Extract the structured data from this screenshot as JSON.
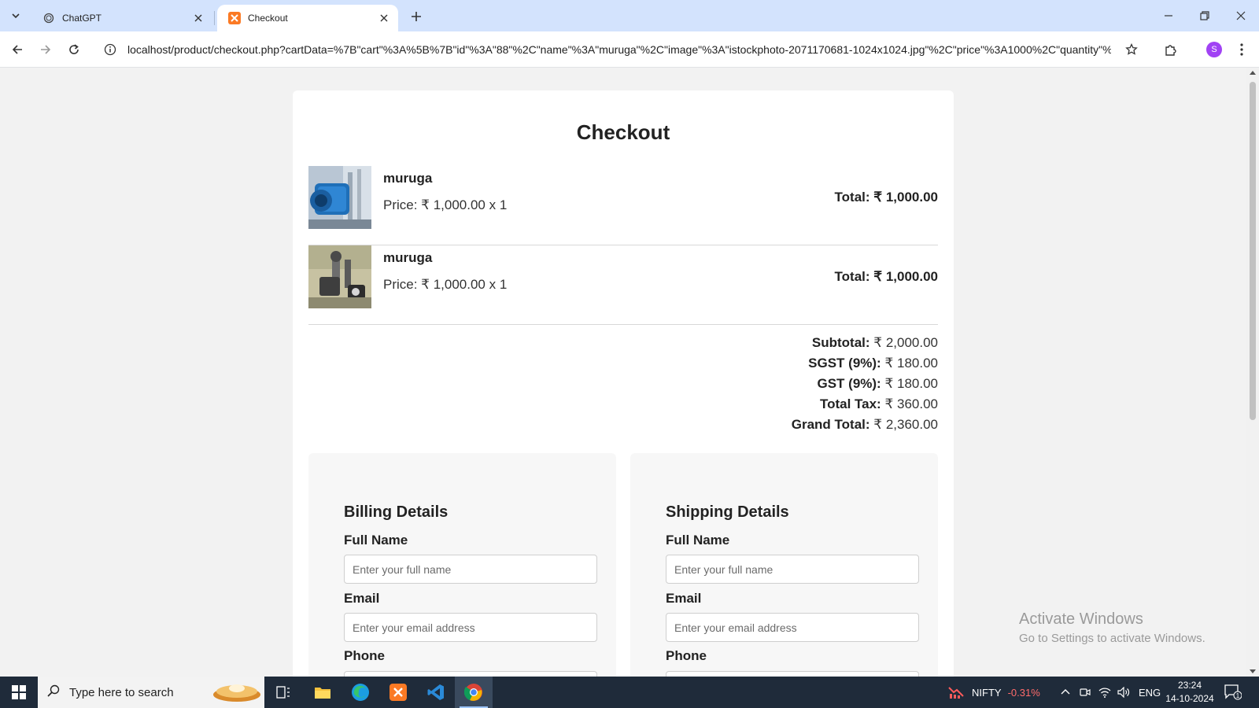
{
  "browser": {
    "tabs": [
      {
        "title": "ChatGPT",
        "active": false
      },
      {
        "title": "Checkout",
        "active": true
      }
    ],
    "url": "localhost/product/checkout.php?cartData=%7B\"cart\"%3A%5B%7B\"id\"%3A\"88\"%2C\"name\"%3A\"muruga\"%2C\"image\"%3A\"istockphoto-2071170681-1024x1024.jpg\"%2C\"price\"%3A1000%2C\"quantity\"%3...",
    "profile_initial": "S"
  },
  "page": {
    "title": "Checkout",
    "items": [
      {
        "name": "muruga",
        "price_line": "Price: ₹ 1,000.00 x 1",
        "total": "Total: ₹ 1,000.00"
      },
      {
        "name": "muruga",
        "price_line": "Price: ₹ 1,000.00 x 1",
        "total": "Total: ₹ 1,000.00"
      }
    ],
    "summary": [
      {
        "label": "Subtotal:",
        "value": "₹ 2,000.00"
      },
      {
        "label": "SGST (9%):",
        "value": "₹ 180.00"
      },
      {
        "label": "GST (9%):",
        "value": "₹ 180.00"
      },
      {
        "label": "Total Tax:",
        "value": "₹ 360.00"
      },
      {
        "label": "Grand Total:",
        "value": "₹ 2,360.00"
      }
    ],
    "billing": {
      "heading": "Billing Details",
      "full_name_label": "Full Name",
      "full_name_placeholder": "Enter your full name",
      "email_label": "Email",
      "email_placeholder": "Enter your email address",
      "phone_label": "Phone"
    },
    "shipping": {
      "heading": "Shipping Details",
      "full_name_label": "Full Name",
      "full_name_placeholder": "Enter your full name",
      "email_label": "Email",
      "email_placeholder": "Enter your email address",
      "phone_label": "Phone"
    },
    "watermark": {
      "line1": "Activate Windows",
      "line2": "Go to Settings to activate Windows."
    }
  },
  "taskbar": {
    "search_placeholder": "Type here to search",
    "ticker_name": "NIFTY",
    "ticker_change": "-0.31%",
    "ticker_color": "#ff6b6b",
    "language": "ENG",
    "time": "23:24",
    "date": "14-10-2024",
    "notification_count": "1"
  }
}
